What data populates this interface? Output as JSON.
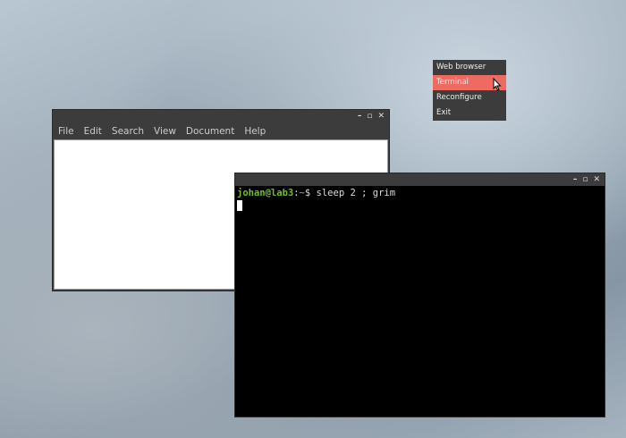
{
  "editor": {
    "controls": {
      "minimize": "–",
      "maximize": "▫",
      "close": "✕"
    },
    "menu": [
      "File",
      "Edit",
      "Search",
      "View",
      "Document",
      "Help"
    ]
  },
  "terminal": {
    "controls": {
      "minimize": "–",
      "maximize": "▫",
      "close": "✕"
    },
    "user_host": "johan@lab3",
    "sep": ":",
    "path": "~",
    "prompt_end": "$ ",
    "command": "sleep 2 ; grim"
  },
  "context_menu": {
    "items": [
      "Web browser",
      "Terminal",
      "Reconfigure",
      "Exit"
    ],
    "selected": "Terminal",
    "selected_color": "#ef6b62"
  }
}
